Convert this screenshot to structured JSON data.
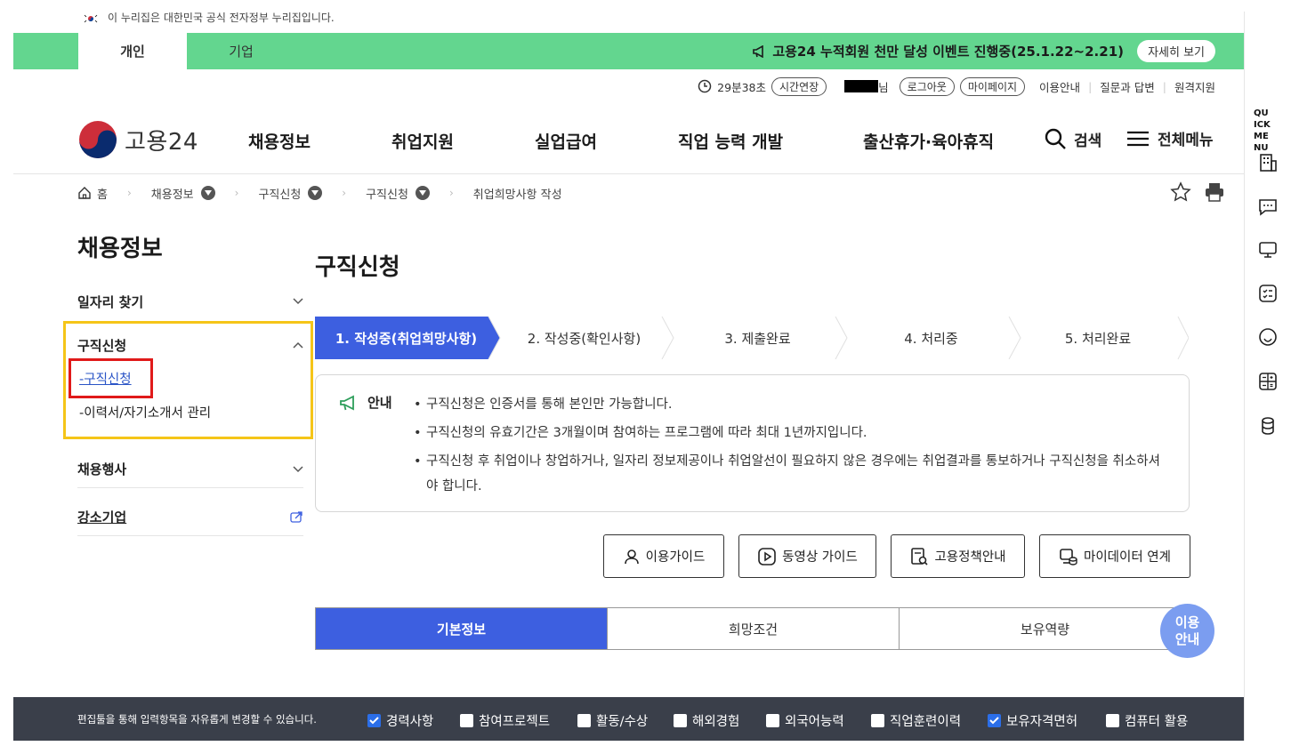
{
  "gov_banner": {
    "text": "이 누리집은 대한민국 공식 전자정부 누리집입니다."
  },
  "top_tabs": {
    "personal": "개인",
    "company": "기업"
  },
  "event": {
    "text": "고용24 누적회원 천만 달성 이벤트 진행중(25.1.22~2.21)",
    "detail_button": "자세히 보기"
  },
  "util": {
    "timer": "29분38초",
    "extend": "시간연장",
    "user_suffix": "님",
    "logout": "로그아웃",
    "mypage": "마이페이지",
    "guide": "이용안내",
    "qna": "질문과 답변",
    "remote": "원격지원"
  },
  "header": {
    "logo_name": "고용24",
    "nav": [
      "채용정보",
      "취업지원",
      "실업급여",
      "직업 능력 개발",
      "출산휴가·육아휴직"
    ],
    "search": "검색",
    "all_menu": "전체메뉴"
  },
  "breadcrumb": [
    "홈",
    "채용정보",
    "구직신청",
    "구직신청",
    "취업희망사항 작성"
  ],
  "lnb": {
    "title": "채용정보",
    "items": {
      "job_search": "일자리 찾기",
      "apply": "구직신청",
      "apply_sub1": "-구직신청",
      "apply_sub2": "-이력서/자기소개서 관리",
      "event": "채용행사",
      "strong": "강소기업"
    }
  },
  "main": {
    "title": "구직신청",
    "steps": [
      "1. 작성중(취업희망사항)",
      "2. 작성중(확인사항)",
      "3. 제출완료",
      "4. 처리중",
      "5. 처리완료"
    ],
    "notice_label": "안내",
    "notice": [
      "구직신청은 인증서를 통해 본인만 가능합니다.",
      "구직신청의 유효기간은 3개월이며 참여하는 프로그램에 따라 최대 1년까지입니다.",
      "구직신청 후 취업이나 창업하거나, 일자리 정보제공이나 취업알선이 필요하지 않은 경우에는 취업결과를 통보하거나 구직신청을 취소하셔야 합니다."
    ],
    "guide_buttons": [
      "이용가이드",
      "동영상 가이드",
      "고용정책안내",
      "마이데이터 연계"
    ],
    "tabs": [
      "기본정보",
      "희망조건",
      "보유역량"
    ],
    "float_help": "이용 안내"
  },
  "bottom_bar": {
    "text": "편집툴을 통해 입력항목을 자유롭게 변경할 수 있습니다.",
    "checks": [
      {
        "label": "경력사항",
        "checked": true
      },
      {
        "label": "참여프로젝트",
        "checked": false
      },
      {
        "label": "활동/수상",
        "checked": false
      },
      {
        "label": "해외경험",
        "checked": false
      },
      {
        "label": "외국어능력",
        "checked": false
      },
      {
        "label": "직업훈련이력",
        "checked": false
      },
      {
        "label": "보유자격면허",
        "checked": true
      },
      {
        "label": "컴퓨터 활용",
        "checked": false
      }
    ]
  },
  "quick_menu": {
    "label": "QUICK MENU"
  },
  "colors": {
    "green": "#63d68f",
    "accent": "#3d5fe0",
    "highlight_yellow": "#f5c518",
    "highlight_red": "#e01a1a",
    "bottom_bar": "#3a3f4a"
  }
}
